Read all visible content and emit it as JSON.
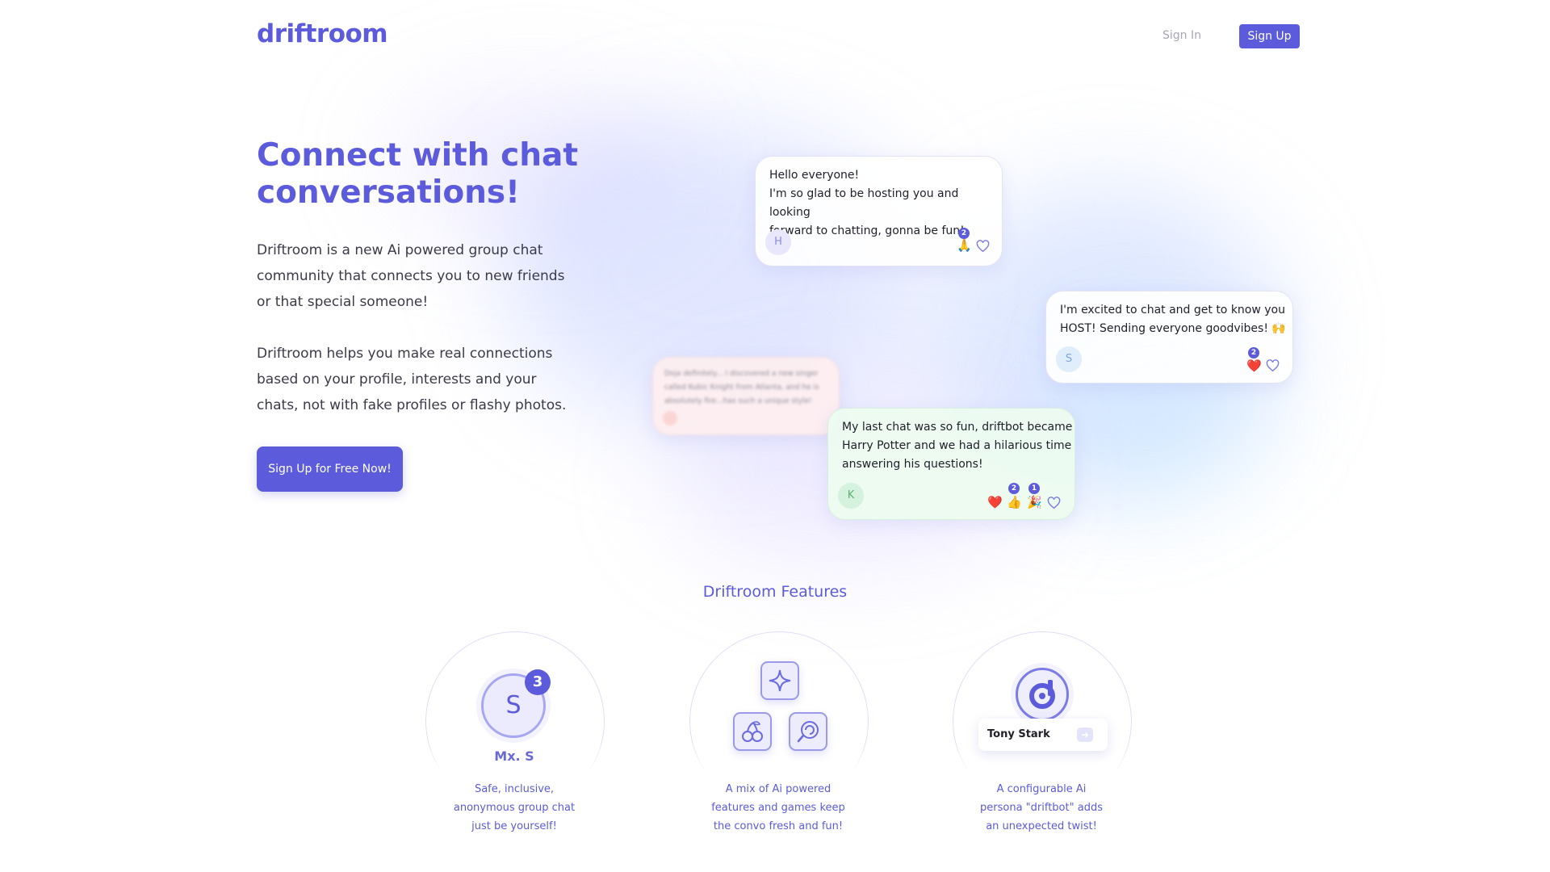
{
  "header": {
    "logo": "driftroom",
    "signin_label": "Sign In",
    "signup_label": "Sign Up"
  },
  "hero": {
    "title": "Connect with chat conversations!",
    "paragraph1": "Driftroom is a new Ai powered group chat community that connects you to new friends or that special someone!",
    "paragraph2": "Driftroom helps you make real connections based on your profile, interests and your chats, not with fake profiles or flashy photos.",
    "cta_label": "Sign Up for Free Now!"
  },
  "chats": {
    "host": {
      "lines": [
        "Hello everyone!",
        "I'm so glad to be hosting you and looking",
        "forward to chatting, gonna be fun!"
      ],
      "avatar": "H",
      "reactions": [
        {
          "emoji": "🙏",
          "count": "2"
        }
      ]
    },
    "excited": {
      "lines": [
        "I'm excited to chat and get to know you",
        "HOST! Sending everyone goodvibes! 🙌"
      ],
      "avatar": "S",
      "reactions": [
        {
          "emoji": "❤️",
          "count": "2"
        }
      ]
    },
    "harry": {
      "lines": [
        "My last chat was so fun, driftbot became",
        "Harry Potter and we had a hilarious time",
        "answering his questions!"
      ],
      "avatar": "K",
      "reactions": [
        {
          "emoji": "❤️",
          "count": ""
        },
        {
          "emoji": "👍",
          "count": "2"
        },
        {
          "emoji": "🎉",
          "count": "1"
        }
      ]
    },
    "blurred": {
      "lines": [
        "Doja definitely... I discovered a new singer",
        "called Kubic Knight from Atlanta, and he is",
        "absolutely fire...has such a unique style!"
      ]
    }
  },
  "features": {
    "title": "Driftroom Features",
    "items": [
      {
        "avatar": "S",
        "badge": "3",
        "name": "Mx. S",
        "lines": [
          "Safe, inclusive,",
          "anonymous group chat",
          "just be yourself!"
        ]
      },
      {
        "lines": [
          "A mix of Ai powered",
          "features and games keep",
          "the convo fresh and fun!"
        ]
      },
      {
        "bot_name": "Tony Stark",
        "lines": [
          "A configurable Ai",
          "persona \"driftbot\" adds",
          "an unexpected twist!"
        ]
      }
    ]
  },
  "colors": {
    "brand": "#5b5bdc",
    "text": "#2c2c3a",
    "muted": "#a7a7b6"
  }
}
